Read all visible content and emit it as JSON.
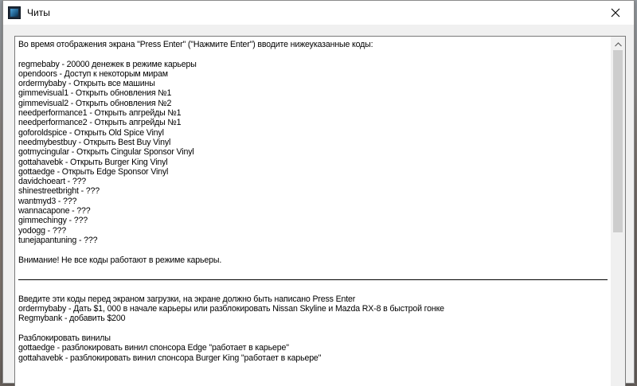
{
  "window": {
    "title": "Читы",
    "close_glyph": "✕"
  },
  "content": {
    "lines": [
      {
        "kind": "text",
        "text": "Во время отображения экрана \"Press Enter\" (\"Нажмите Enter\") вводите нижеуказанные коды:"
      },
      {
        "kind": "blank",
        "text": ""
      },
      {
        "kind": "text",
        "text": "regmebaby - 20000 денежек в режиме карьеры"
      },
      {
        "kind": "text",
        "text": "opendoors - Доступ к некоторым мирам"
      },
      {
        "kind": "text",
        "text": "ordermybaby - Открыть все машины"
      },
      {
        "kind": "text",
        "text": "gimmevisual1 - Открыть обновления №1"
      },
      {
        "kind": "text",
        "text": "gimmevisual2 - Открыть обновления №2"
      },
      {
        "kind": "text",
        "text": "needperformance1 - Открыть апгрейды №1"
      },
      {
        "kind": "text",
        "text": "needperformance2 - Открыть апгрейды №1"
      },
      {
        "kind": "text",
        "text": "goforoldspice - Открыть Old Spice Vinyl"
      },
      {
        "kind": "text",
        "text": "needmybestbuy - Открыть Best Buy Vinyl"
      },
      {
        "kind": "text",
        "text": "gotmycingular - Открыть Cingular Sponsor Vinyl"
      },
      {
        "kind": "text",
        "text": "gottahavebk - Открыть Burger King Vinyl"
      },
      {
        "kind": "text",
        "text": "gottaedge - Открыть Edge Sponsor Vinyl"
      },
      {
        "kind": "text",
        "text": "davidchoeart - ???"
      },
      {
        "kind": "text",
        "text": "shinestreetbright - ???"
      },
      {
        "kind": "text",
        "text": "wantmyd3 - ???"
      },
      {
        "kind": "text",
        "text": "wannacapone - ???"
      },
      {
        "kind": "text",
        "text": "gimmechingy - ???"
      },
      {
        "kind": "text",
        "text": "yodogg - ???"
      },
      {
        "kind": "text",
        "text": "tunejapantuning - ???"
      },
      {
        "kind": "blank",
        "text": ""
      },
      {
        "kind": "text",
        "text": "Внимание! Не все коды работают в режиме карьеры."
      },
      {
        "kind": "blank",
        "text": ""
      },
      {
        "kind": "separator",
        "text": ""
      },
      {
        "kind": "blank",
        "text": ""
      },
      {
        "kind": "text",
        "text": "Введите эти коды перед экраном загрузки, на экране должно быть написано Press Enter"
      },
      {
        "kind": "text",
        "text": "ordermybaby - Дать $1, 000 в начале карьеры или разблокировать Nissan Skyline и Mazda RX-8 в быстрой гонке"
      },
      {
        "kind": "text",
        "text": "Regmybank - добавить $200"
      },
      {
        "kind": "blank",
        "text": ""
      },
      {
        "kind": "text",
        "text": "Разблокировать винилы"
      },
      {
        "kind": "text",
        "text": "gottaedge - разблокировать винил спонсора Edge \"работает в карьере\""
      },
      {
        "kind": "text",
        "text": "gottahavebk - разблокировать винил спонсора Burger King \"работает в карьере\""
      }
    ]
  },
  "scrollbar": {
    "scroll_fraction": 0.0,
    "visible_fraction": 0.55
  },
  "colors": {
    "titlebar_bg": "#ffffff",
    "client_bg": "#f0f0f0",
    "textbox_bg": "#ffffff",
    "thumb": "#cdcdcd"
  },
  "icons": {
    "app": "app-icon",
    "close": "close-icon",
    "scroll_up": "chevron-up-icon",
    "scroll_down": "chevron-down-icon"
  }
}
